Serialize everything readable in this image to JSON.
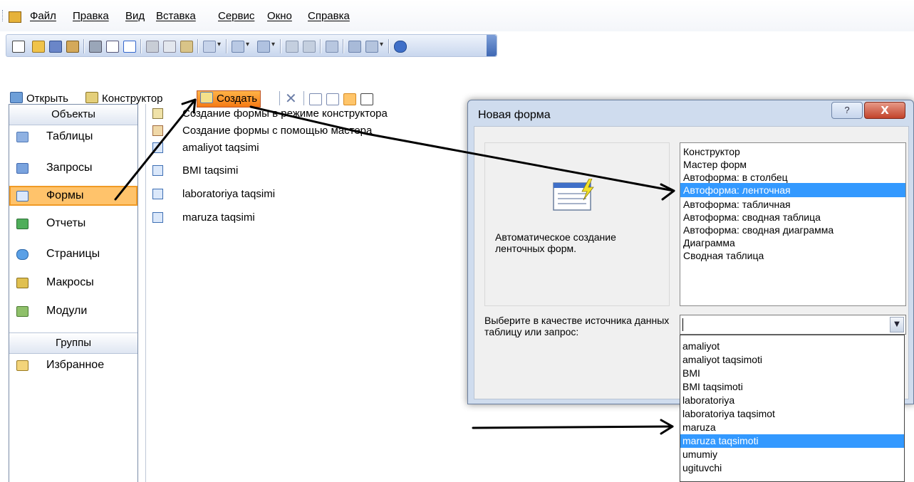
{
  "menu": {
    "items": [
      "Файл",
      "Правка",
      "Вид",
      "Вставка",
      "Сервис",
      "Окно",
      "Справка"
    ]
  },
  "toolbar": {
    "icons": [
      "new-file-icon",
      "open-folder-icon",
      "save-icon",
      "permissions-icon",
      "print-icon",
      "print-preview-icon",
      "spelling-icon",
      "cut-icon",
      "copy-icon",
      "paste-icon",
      "undo-icon",
      "office-links-icon",
      "analyze-icon",
      "code-icon",
      "script-editor-icon",
      "properties-icon",
      "relationships-icon",
      "new-object-icon",
      "help-icon"
    ]
  },
  "db_toolbar": {
    "open_label": "Открыть",
    "design_label": "Конструктор",
    "create_label": "Создать"
  },
  "objects_pane": {
    "objects_header": "Объекты",
    "items": [
      {
        "label": "Таблицы",
        "icon": "table-icon",
        "color": "#6f97d2"
      },
      {
        "label": "Запросы",
        "icon": "query-icon",
        "color": "#5a8fd8"
      },
      {
        "label": "Формы",
        "icon": "form-icon",
        "color": "#5a8fd8"
      },
      {
        "label": "Отчеты",
        "icon": "report-icon",
        "color": "#3a9a4a"
      },
      {
        "label": "Страницы",
        "icon": "page-icon",
        "color": "#2f7fd0"
      },
      {
        "label": "Макросы",
        "icon": "macro-icon",
        "color": "#d8b33a"
      },
      {
        "label": "Модули",
        "icon": "module-icon",
        "color": "#5a9a3a"
      }
    ],
    "groups_header": "Группы",
    "favorites_label": "Избранное"
  },
  "forms_list": [
    "Создание формы в режиме конструктора",
    "Создание формы с помощью мастера",
    "amaliyot taqsimi",
    "BMI taqsimi",
    "laboratoriya taqsimi",
    "maruza taqsimi"
  ],
  "dialog": {
    "title": "Новая форма",
    "help": "?",
    "close": "X",
    "description": "Автоматическое создание ленточных форм.",
    "wizard_options": [
      "Конструктор",
      "Мастер форм",
      "Автоформа: в столбец",
      "Автоформа: ленточная",
      "Автоформа: табличная",
      "Автоформа:  сводная таблица",
      "Автоформа:  сводная диаграмма",
      "Диаграмма",
      "Сводная таблица"
    ],
    "selected_wizard": "Автоформа: ленточная",
    "source_label": "Выберите в качестве источника данных таблицу или запрос:",
    "source_value": "",
    "source_options": [
      "amaliyot",
      "amaliyot taqsimoti",
      "BMI",
      "BMI taqsimoti",
      "laboratoriya",
      "laboratoriya taqsimot",
      "maruza",
      "maruza taqsimoti",
      "umumiy",
      "ugituvchi"
    ],
    "selected_source": "maruza taqsimoti"
  }
}
